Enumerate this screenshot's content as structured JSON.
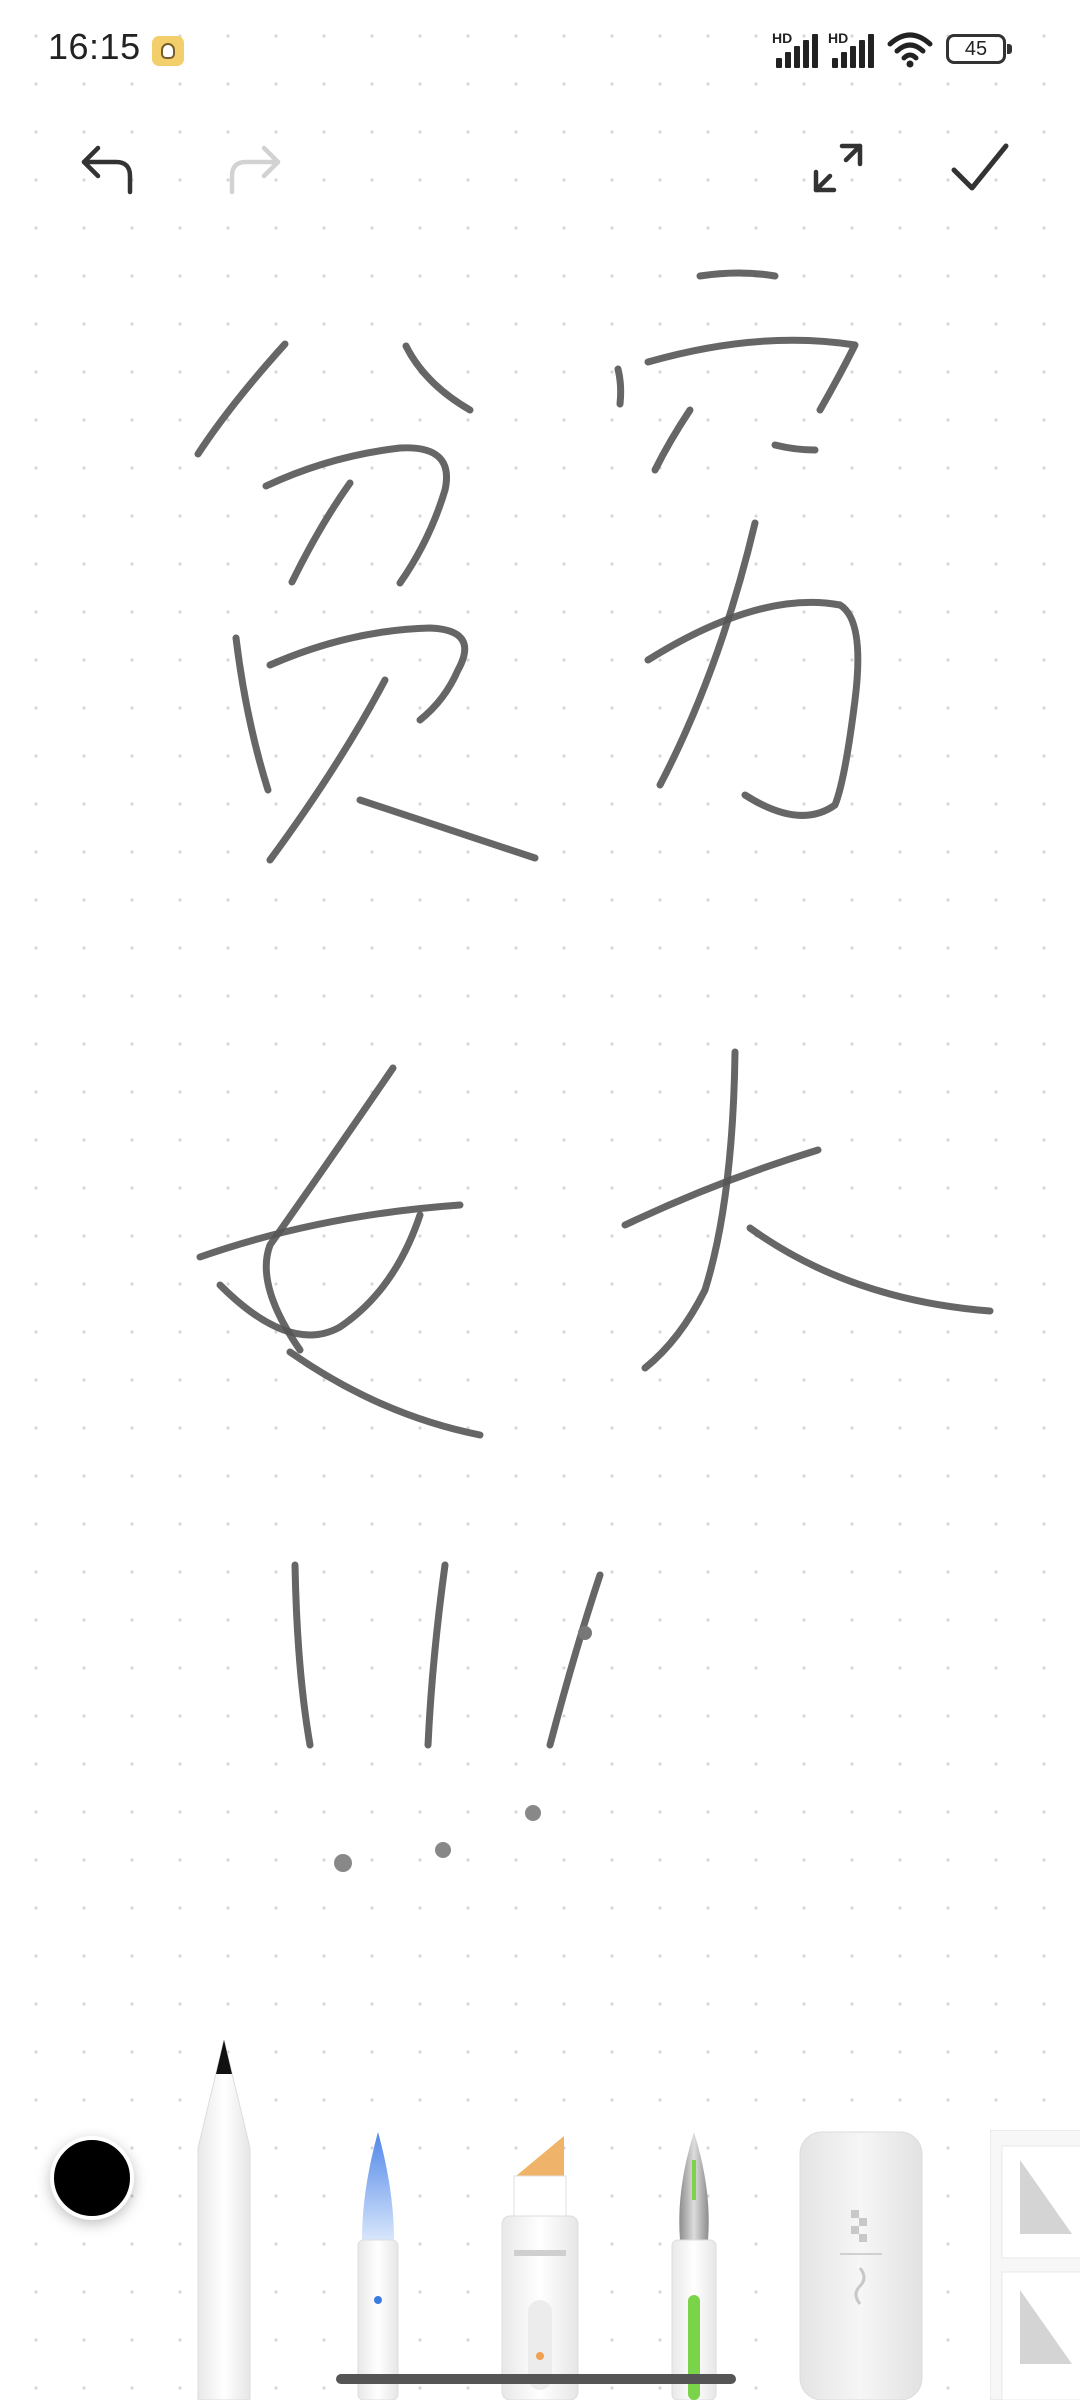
{
  "status_bar": {
    "time": "16:15",
    "signal_label_1": "HD",
    "signal_label_2": "HD",
    "battery": "45"
  },
  "toolbar": {
    "undo_icon": "undo-arrow",
    "redo_icon": "redo-arrow",
    "fullscreen_icon": "expand",
    "done_icon": "checkmark"
  },
  "bottom_tools": {
    "selected_color": "#000000",
    "items": [
      "pencil",
      "fountain-brush",
      "highlighter",
      "fountain-pen",
      "eraser",
      "shapes-ruler"
    ]
  },
  "colors": {
    "stroke": "#555555",
    "highlighter_tip": "#f0b36a",
    "fountain_pen_accent": "#7bd34a",
    "brush_tip": "#7aa8f0"
  }
}
